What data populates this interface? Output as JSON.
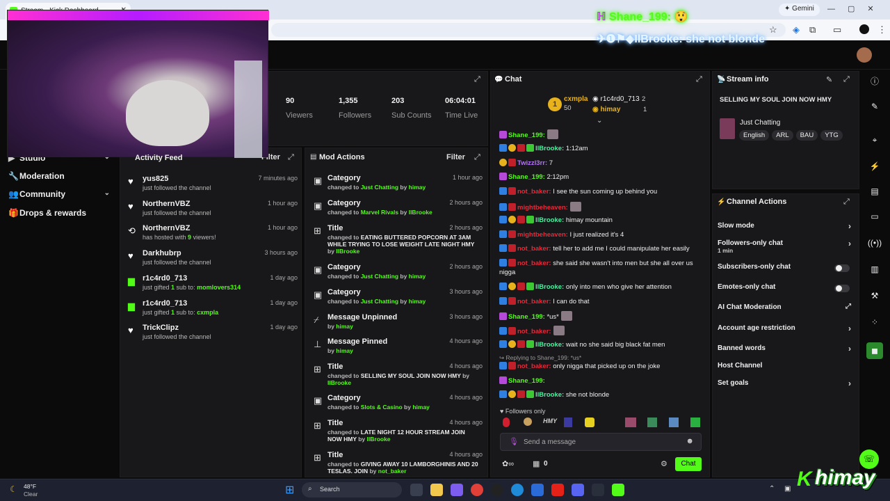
{
  "browser": {
    "tab_title": "Stream - Kick Dashboard",
    "gemini_label": "Gemini"
  },
  "overlay": {
    "chat_line1_user": "Shane_199:",
    "chat_line2_user": "IlBrooke:",
    "chat_line2_text": " she not blonde"
  },
  "sidebar": [
    {
      "label": "Studio",
      "icon": "video-icon",
      "chevron": true
    },
    {
      "label": "Moderation",
      "icon": "wrench-icon",
      "chevron": false
    },
    {
      "label": "Community",
      "icon": "people-icon",
      "chevron": true
    },
    {
      "label": "Drops & rewards",
      "icon": "gift-icon",
      "chevron": false
    }
  ],
  "stats": [
    {
      "value": "90",
      "label": "Viewers"
    },
    {
      "value": "1,355",
      "label": "Followers"
    },
    {
      "value": "203",
      "label": "Sub Counts"
    },
    {
      "value": "06:04:01",
      "label": "Time Live"
    }
  ],
  "activity": {
    "title": "Activity Feed",
    "filter": "Filter",
    "items": [
      {
        "name": "yus825",
        "desc": "just followed the channel",
        "time": "7 minutes ago",
        "icon": "heart-icon"
      },
      {
        "name": "NorthernVBZ",
        "desc": "just followed the channel",
        "time": "1 hour ago",
        "icon": "heart-icon"
      },
      {
        "name": "NorthernVBZ",
        "desc_pre": "has hosted with ",
        "desc_hl": "9",
        "desc_post": " viewers!",
        "time": "1 hour ago",
        "icon": "host-icon"
      },
      {
        "name": "Darkhubrp",
        "desc": "just followed the channel",
        "time": "3 hours ago",
        "icon": "heart-icon"
      },
      {
        "name": "r1c4rd0_713",
        "desc_pre": "just gifted ",
        "desc_hl": "1",
        "desc_mid": " sub to: ",
        "desc_hl2": "momlovers314",
        "time": "1 day ago",
        "icon": "gift-icon"
      },
      {
        "name": "r1c4rd0_713",
        "desc_pre": "just gifted ",
        "desc_hl": "1",
        "desc_mid": " sub to: ",
        "desc_hl2": "cxmpla",
        "time": "1 day ago",
        "icon": "gift-icon"
      },
      {
        "name": "TrickClipz",
        "desc": "just followed the channel",
        "time": "1 day ago",
        "icon": "heart-icon"
      }
    ]
  },
  "mod": {
    "title": "Mod Actions",
    "filter": "Filter",
    "items": [
      {
        "name": "Category",
        "pre": "changed to ",
        "val": "Just Chatting",
        "by": "himay",
        "time": "1 hour ago",
        "icon": "category-icon"
      },
      {
        "name": "Category",
        "pre": "changed to ",
        "val": "Marvel Rivals",
        "by": "IlBrooke",
        "time": "2 hours ago",
        "icon": "category-icon"
      },
      {
        "name": "Title",
        "pre": "changed to ",
        "val": "EATING BUTTERED POPCORN AT 3AM WHILE TRYING TO LOSE WEIGHT LATE NIGHT HMY",
        "by": "IlBrooke",
        "time": "2 hours ago",
        "icon": "title-icon"
      },
      {
        "name": "Category",
        "pre": "changed to ",
        "val": "Just Chatting",
        "by": "himay",
        "time": "2 hours ago",
        "icon": "category-icon"
      },
      {
        "name": "Category",
        "pre": "changed to ",
        "val": "Just Chatting",
        "by": "himay",
        "time": "3 hours ago",
        "icon": "category-icon"
      },
      {
        "name": "Message Unpinned",
        "pre": "",
        "val": "",
        "by": "himay",
        "time": "3 hours ago",
        "icon": "unpin-icon"
      },
      {
        "name": "Message Pinned",
        "pre": "",
        "val": "",
        "by": "himay",
        "time": "4 hours ago",
        "icon": "pin-icon"
      },
      {
        "name": "Title",
        "pre": "changed to ",
        "val": "SELLING MY SOUL JOIN NOW HMY",
        "by": "IlBrooke",
        "time": "4 hours ago",
        "icon": "title-icon"
      },
      {
        "name": "Category",
        "pre": "changed to ",
        "val": "Slots & Casino",
        "by": "himay",
        "time": "4 hours ago",
        "icon": "category-icon"
      },
      {
        "name": "Title",
        "pre": "changed to ",
        "val": "LATE NIGHT 12 HOUR STREAM JOIN NOW HMY",
        "by": "IlBrooke",
        "time": "4 hours ago",
        "icon": "title-icon"
      },
      {
        "name": "Title",
        "pre": "changed to ",
        "val": "GIVING AWAY 10 LAMBORGHINIS AND 20 TESLAS. JOIN",
        "by": "not_baker",
        "time": "4 hours ago",
        "icon": "title-icon"
      }
    ]
  },
  "chat": {
    "title": "Chat",
    "leader1_name": "cxmpla",
    "leader1_count": "50",
    "leader2_name": "r1c4rd0_713",
    "leader2_count": "2",
    "leader3_name": "himay",
    "leader3_count": "1",
    "messages": [
      {
        "user": "Shane_199:",
        "cls": "u-g",
        "badges": "p",
        "text": "",
        "emote": true
      },
      {
        "user": "IlBrooke:",
        "cls": "u-c",
        "badges": "byrg",
        "text": " 1:12am"
      },
      {
        "user": "Twizzl3rr:",
        "cls": "u-p",
        "badges": "yr",
        "text": " 7"
      },
      {
        "user": "Shane_199:",
        "cls": "u-g",
        "badges": "p",
        "text": " 2:12pm"
      },
      {
        "user": "not_baker:",
        "cls": "u-r",
        "badges": "br",
        "text": " I see the sun coming up behind you"
      },
      {
        "user": "mightbeheaven:",
        "cls": "u-r",
        "badges": "br",
        "text": "",
        "emote": true
      },
      {
        "user": "IlBrooke:",
        "cls": "u-c",
        "badges": "byrg",
        "text": " himay mountain"
      },
      {
        "user": "mightbeheaven:",
        "cls": "u-r",
        "badges": "br",
        "text": " I just realized it's 4"
      },
      {
        "user": "not_baker:",
        "cls": "u-r",
        "badges": "br",
        "text": " tell her to add me I could manipulate her easily"
      },
      {
        "user": "not_baker:",
        "cls": "u-r",
        "badges": "br",
        "text": " she said she wasn't into men but she all over us nigga"
      },
      {
        "user": "IlBrooke:",
        "cls": "u-c",
        "badges": "byrg",
        "text": " only into men who give her attention"
      },
      {
        "user": "not_baker:",
        "cls": "u-r",
        "badges": "br",
        "text": " I can do that"
      },
      {
        "user": "Shane_199:",
        "cls": "u-g",
        "badges": "p",
        "text": " *us*",
        "emote": true
      },
      {
        "user": "not_baker:",
        "cls": "u-r",
        "badges": "br",
        "text": "",
        "emote": true
      },
      {
        "user": "IlBrooke:",
        "cls": "u-c",
        "badges": "byrg",
        "text": " wait no she said big black fat men"
      },
      {
        "user": "not_baker:",
        "cls": "u-r",
        "badges": "br",
        "text": " only nigga that picked up on the joke",
        "reply": "Replying to Shane_199: *us*"
      },
      {
        "user": "Shane_199:",
        "cls": "u-g",
        "badges": "p",
        "text": ""
      },
      {
        "user": "IlBrooke:",
        "cls": "u-c",
        "badges": "byrg",
        "text": " she not blonde"
      }
    ],
    "followers_only": "Followers only",
    "input_placeholder": "Send a message",
    "points": "0",
    "send_label": "Chat"
  },
  "stream_info": {
    "title": "Stream info",
    "stream_title": "SELLING MY SOUL JOIN NOW HMY",
    "category": "Just Chatting",
    "tags": [
      "English",
      "ARL",
      "BAU",
      "YTG"
    ]
  },
  "channel_actions": {
    "title": "Channel Actions",
    "items": [
      {
        "label": "Slow mode",
        "kind": "chevron"
      },
      {
        "label": "Followers-only chat",
        "sub": "1 min",
        "kind": "chevron"
      },
      {
        "label": "Subscribers-only chat",
        "kind": "toggle"
      },
      {
        "label": "Emotes-only chat",
        "kind": "toggle"
      },
      {
        "label": "AI Chat Moderation",
        "kind": "external"
      },
      {
        "label": "Account age restriction",
        "kind": "chevron"
      },
      {
        "label": "Banned words",
        "kind": "chevron"
      },
      {
        "label": "Host Channel",
        "kind": "none"
      },
      {
        "label": "Set goals",
        "kind": "chevron"
      }
    ]
  },
  "taskbar": {
    "weather_temp": "48°F",
    "weather_desc": "Clear",
    "search_label": "Search",
    "brand": "himay"
  },
  "colors": {
    "accent": "#53fc18",
    "panel": "#18181b",
    "bg": "#0b0b0c"
  }
}
